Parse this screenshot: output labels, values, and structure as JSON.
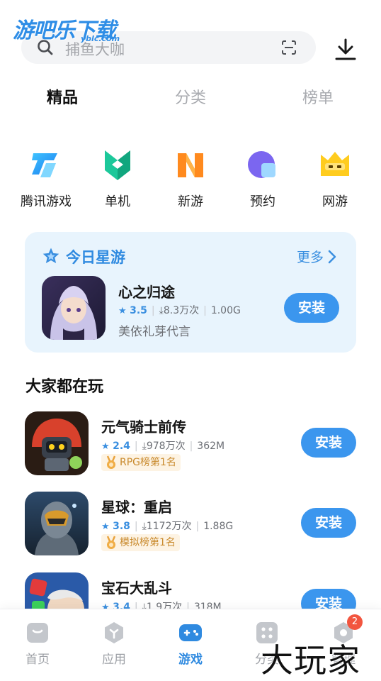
{
  "watermark": {
    "logo_text": "游吧乐下载",
    "logo_sub": "yblc.com",
    "bottom_text": "大玩家"
  },
  "search": {
    "placeholder": "捕鱼大咖"
  },
  "tabs": [
    {
      "label": "精品",
      "active": true
    },
    {
      "label": "分类",
      "active": false
    },
    {
      "label": "榜单",
      "active": false
    }
  ],
  "categories": [
    {
      "label": "腾讯游戏",
      "icon": "tencent-games-icon"
    },
    {
      "label": "单机",
      "icon": "single-player-icon"
    },
    {
      "label": "新游",
      "icon": "new-games-icon"
    },
    {
      "label": "预约",
      "icon": "reservation-icon"
    },
    {
      "label": "网游",
      "icon": "online-games-icon"
    }
  ],
  "today_star": {
    "title": "今日星游",
    "more": "更多",
    "game": {
      "name": "心之归途",
      "rating": "3.5",
      "downloads": "8.3万次",
      "size": "1.00G",
      "desc": "美依礼芽代言",
      "install": "安装"
    }
  },
  "section": {
    "title": "大家都在玩"
  },
  "games": [
    {
      "name": "元气骑士前传",
      "rating": "2.4",
      "downloads": "978万次",
      "size": "362M",
      "badge": "RPG榜第1名",
      "install": "安装"
    },
    {
      "name": "星球：重启",
      "rating": "3.8",
      "downloads": "1172万次",
      "size": "1.88G",
      "badge": "模拟榜第1名",
      "install": "安装"
    },
    {
      "name": "宝石大乱斗",
      "rating": "3.4",
      "downloads": "1.9万次",
      "size": "318M",
      "badge": "",
      "install": "安装"
    }
  ],
  "bottom_nav": [
    {
      "label": "首页",
      "icon": "home-icon",
      "active": false
    },
    {
      "label": "应用",
      "icon": "apps-icon",
      "active": false
    },
    {
      "label": "游戏",
      "icon": "gamepad-icon",
      "active": true
    },
    {
      "label": "分类",
      "icon": "category-icon",
      "active": false
    },
    {
      "label": "管理",
      "icon": "manage-icon",
      "active": false,
      "badge": "2"
    }
  ],
  "colors": {
    "accent": "#3b96ee",
    "badge_red": "#f2553f",
    "card_bg": "#e8f4fd"
  }
}
